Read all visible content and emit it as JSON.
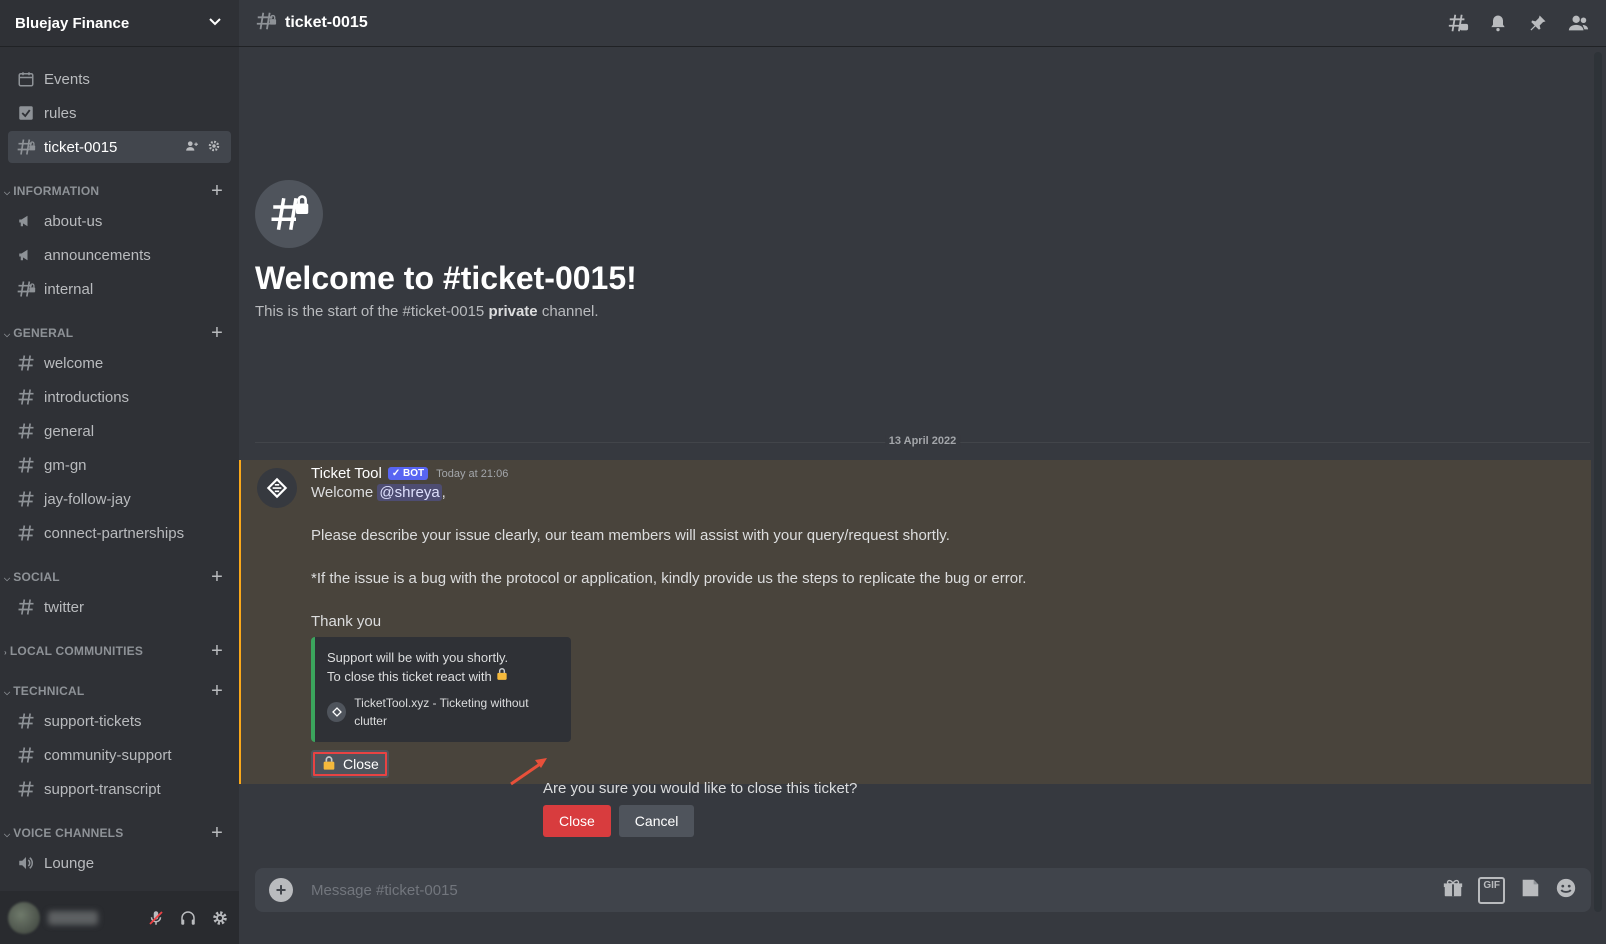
{
  "server": {
    "name": "Bluejay Finance"
  },
  "top_channels": [
    {
      "label": "Events",
      "icon": "calendar-icon"
    },
    {
      "label": "rules",
      "icon": "checkbox-icon"
    },
    {
      "label": "ticket-0015",
      "icon": "locked-hash-icon",
      "active": true
    }
  ],
  "categories": [
    {
      "name": "INFORMATION",
      "channels": [
        {
          "label": "about-us",
          "icon": "megaphone-icon"
        },
        {
          "label": "announcements",
          "icon": "megaphone-icon"
        },
        {
          "label": "internal",
          "icon": "locked-hash-icon"
        }
      ]
    },
    {
      "name": "GENERAL",
      "channels": [
        {
          "label": "welcome"
        },
        {
          "label": "introductions"
        },
        {
          "label": "general"
        },
        {
          "label": "gm-gn"
        },
        {
          "label": "jay-follow-jay"
        },
        {
          "label": "connect-partnerships"
        }
      ]
    },
    {
      "name": "SOCIAL",
      "channels": [
        {
          "label": "twitter"
        }
      ]
    },
    {
      "name": "LOCAL COMMUNITIES",
      "collapsed": true,
      "channels": []
    },
    {
      "name": "TECHNICAL",
      "channels": [
        {
          "label": "support-tickets"
        },
        {
          "label": "community-support"
        },
        {
          "label": "support-transcript"
        }
      ]
    },
    {
      "name": "VOICE CHANNELS",
      "channels": [
        {
          "label": "Lounge",
          "icon": "speaker-icon"
        }
      ]
    }
  ],
  "header": {
    "channel": "ticket-0015"
  },
  "welcome": {
    "title": "Welcome to #ticket-0015!",
    "subtitle_pre": "This is the start of the #ticket-0015 ",
    "subtitle_bold": "private",
    "subtitle_post": " channel."
  },
  "date_divider": "13 April 2022",
  "message": {
    "author": "Ticket Tool",
    "badge": "✓ BOT",
    "timestamp": "Today at 21:06",
    "line1_pre": "Welcome ",
    "mention": "@shreya",
    "line1_post": ",",
    "line2": "Please describe your issue clearly, our team members will assist with your query/request shortly.",
    "line3": "*If the issue is a bug with the protocol or application, kindly provide us the steps to replicate the bug or error.",
    "line4": "Thank you",
    "embed": {
      "line1": "Support will be with you shortly.",
      "line2": "To close this ticket react with",
      "footer": "TicketTool.xyz - Ticketing without clutter"
    },
    "close_button": "Close"
  },
  "confirm": {
    "question": "Are you sure you would like to close this ticket?",
    "confirm_label": "Close",
    "cancel_label": "Cancel"
  },
  "composer": {
    "placeholder": "Message #ticket-0015"
  },
  "colors": {
    "accent": "#5865f2",
    "danger": "#d83c3e",
    "highlight": "#faa81a",
    "embed_bar": "#3ba55d"
  }
}
